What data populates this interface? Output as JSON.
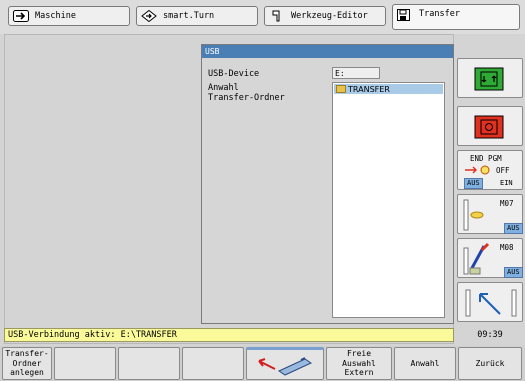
{
  "tabs": [
    {
      "label": "Maschine",
      "icon": "arrow-right-icon"
    },
    {
      "label": "smart.Turn",
      "icon": "diamond-arrow-icon"
    },
    {
      "label": "Werkzeug-Editor",
      "icon": "tool-icon"
    },
    {
      "label": "Transfer",
      "icon": "floppy-icon",
      "active": true
    }
  ],
  "dialog": {
    "title": "USB",
    "device_label": "USB-Device",
    "device_value": "E:",
    "select_label_1": "Anwahl",
    "select_label_2": "Transfer-Ordner",
    "folders": [
      "TRANSFER"
    ]
  },
  "status": {
    "text": "USB-Verbindung aktiv: E:\\TRANSFER"
  },
  "clock": "09:39",
  "sidebar": {
    "end_pgm": "END PGM",
    "off": "OFF",
    "aus": "AUS",
    "ein": "EIN",
    "m07": "M07",
    "m08": "M08"
  },
  "softkeys": [
    "Transfer-\nOrdner\nanlegen",
    "",
    "",
    "",
    "",
    "Freie\nAuswahl\nExtern",
    "Anwahl",
    "Zurück"
  ],
  "colors": {
    "title_bar": "#4a7fb5",
    "status_bg": "#fafa9a",
    "selection": "#a9cbe8"
  }
}
